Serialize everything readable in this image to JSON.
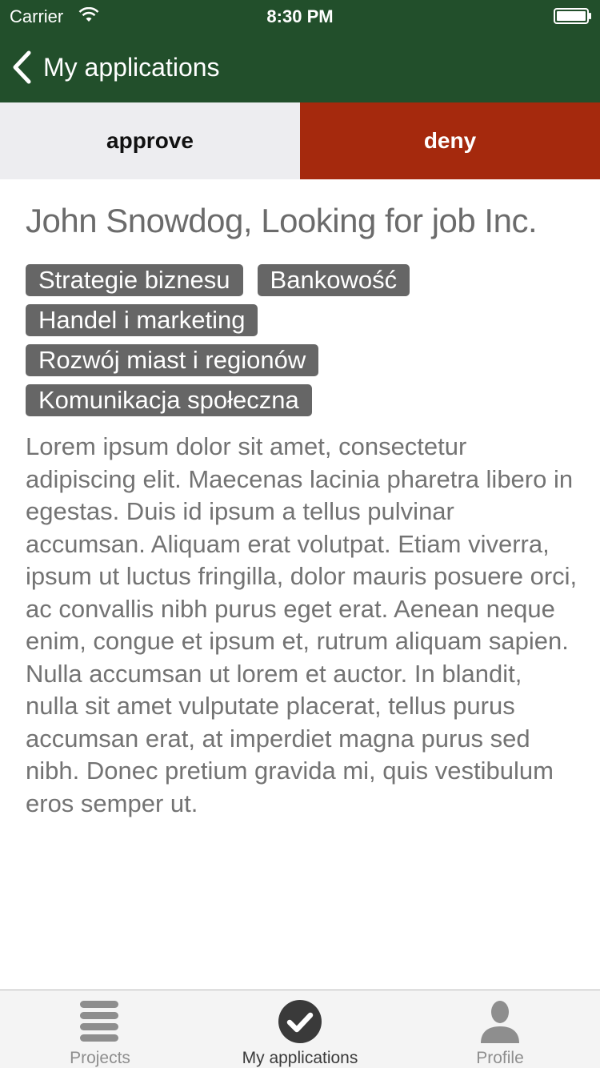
{
  "status_bar": {
    "carrier": "Carrier",
    "time": "8:30 PM"
  },
  "nav": {
    "back_title": "My applications"
  },
  "actions": {
    "approve_label": "approve",
    "deny_label": "deny"
  },
  "applicant": {
    "title": "John Snowdog, Looking for job Inc.",
    "tags": [
      "Strategie biznesu",
      "Bankowość",
      "Handel i marketing",
      "Rozwój miast i regionów",
      "Komunikacja społeczna"
    ],
    "description": "Lorem ipsum dolor sit amet, consectetur adipiscing elit. Maecenas lacinia pharetra libero in egestas. Duis id ipsum a tellus pulvinar accumsan. Aliquam erat volutpat. Etiam viverra, ipsum ut luctus fringilla, dolor mauris posuere orci, ac convallis nibh purus eget erat. Aenean neque enim, congue et ipsum et, rutrum aliquam sapien. Nulla accumsan ut lorem et auctor. In blandit, nulla sit amet vulputate placerat, tellus purus accumsan erat, at imperdiet magna purus sed nibh. Donec pretium gravida mi, quis vestibulum eros semper ut."
  },
  "tab_bar": {
    "tabs": [
      {
        "label": "Projects",
        "icon": "list-icon",
        "active": false
      },
      {
        "label": "My applications",
        "icon": "checkmark-circle-icon",
        "active": true
      },
      {
        "label": "Profile",
        "icon": "person-icon",
        "active": false
      }
    ]
  },
  "colors": {
    "header_bg": "#224f2b",
    "approve_bg": "#ededf0",
    "deny_bg": "#a5290d",
    "tag_bg": "#666666",
    "text_gray": "#737373"
  }
}
